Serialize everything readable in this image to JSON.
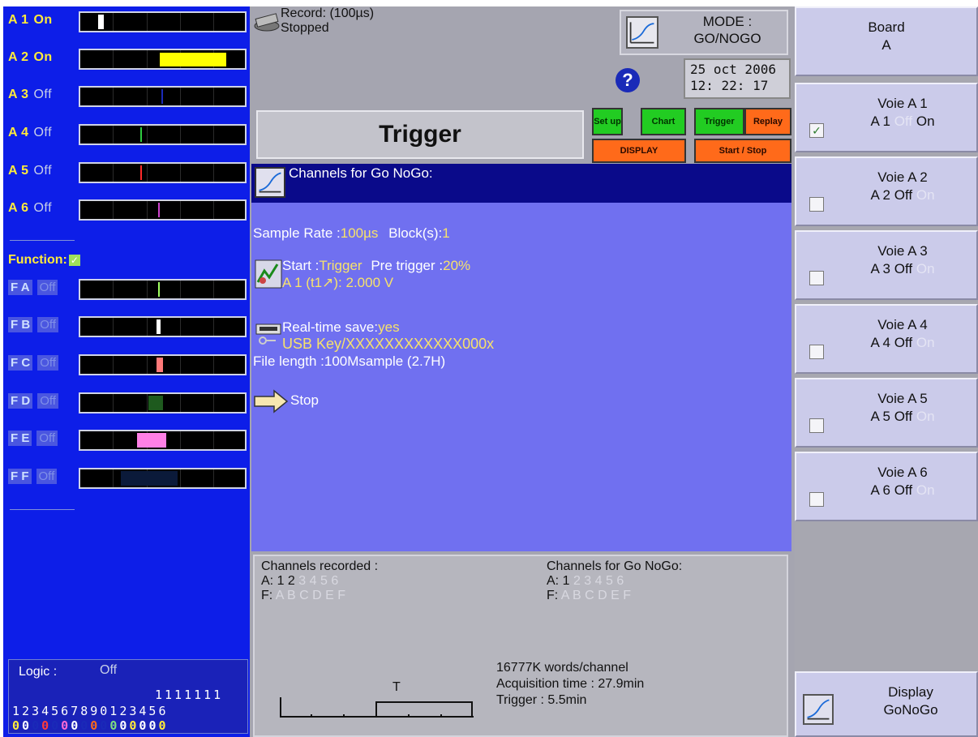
{
  "left": {
    "channels": [
      {
        "name": "A",
        "num": "1",
        "state": "On"
      },
      {
        "name": "A",
        "num": "2",
        "state": "On"
      },
      {
        "name": "A",
        "num": "3",
        "state": "Off"
      },
      {
        "name": "A",
        "num": "4",
        "state": "Off"
      },
      {
        "name": "A",
        "num": "5",
        "state": "Off"
      },
      {
        "name": "A",
        "num": "6",
        "state": "Off"
      }
    ],
    "function_label": "Function:",
    "function_check": "✓",
    "functions": [
      {
        "letter": "A",
        "state": "Off"
      },
      {
        "letter": "B",
        "state": "Off"
      },
      {
        "letter": "C",
        "state": "Off"
      },
      {
        "letter": "D",
        "state": "Off"
      },
      {
        "letter": "E",
        "state": "Off"
      },
      {
        "letter": "F",
        "state": "Off"
      }
    ],
    "logic": {
      "label": "Logic :",
      "value": "Off",
      "row1": "1111111",
      "row2": "1234567890123456",
      "row3": [
        "0",
        "0",
        "0",
        "0",
        "0",
        "0",
        "0",
        "0",
        "0",
        "0",
        "0",
        "0",
        "0",
        "0",
        "0",
        "0"
      ],
      "row3_colors": [
        "#ffeb3b",
        "#ffffff",
        "#1a2ab8",
        "#ff3b3b",
        "#1a2ab8",
        "#ff6ad5",
        "#ffffff",
        "#1a2ab8",
        "#ff6a1a",
        "#1a2ab8",
        "#7fe07f",
        "#ffffff",
        "#ffeb3b",
        "#ffffff",
        "#ffffff",
        "#ffeb3b"
      ]
    }
  },
  "center": {
    "record_line1": "Record: (100µs)",
    "record_line2": "Stopped",
    "mode_line1": "MODE :",
    "mode_line2": "GO/NOGO",
    "help": "?",
    "date": "25 oct 2006",
    "time": "12: 22: 17",
    "title": "Trigger",
    "tabs": {
      "setup": "Set up",
      "chart": "Chart",
      "trigger": "Trigger",
      "replay": "Replay",
      "display": "DISPLAY",
      "startstop": "Start / Stop"
    },
    "header": "Channels for Go NoGo:",
    "sample_rate_label": "Sample Rate :",
    "sample_rate_value": "100µs",
    "blocks_label": "Block(s):",
    "blocks_value": "1",
    "start_label": "Start :",
    "start_value": "Trigger",
    "pretrigger_label": "Pre trigger :",
    "pretrigger_value": "20%",
    "trigger_cond": "A 1 (t1↗):  2.000 V",
    "realtime_label": "Real-time save:",
    "realtime_value": "yes",
    "usb_path": "USB Key/XXXXXXXXXXXX000x",
    "file_length": "File length :100Msample  (2.7H)",
    "stop_label": "Stop",
    "bottom": {
      "recorded_title": "Channels recorded :",
      "recorded_a_prefix": "A:",
      "recorded_a_on": "1 2",
      "recorded_a_off": "3 4 5 6",
      "recorded_f_prefix": "F:",
      "recorded_f_off": "A B C D E F",
      "gonogo_title": "Channels for Go NoGo:",
      "gonogo_a_prefix": "A:",
      "gonogo_a_on": "1",
      "gonogo_a_off": "2 3 4 5 6",
      "gonogo_f_prefix": "F:",
      "gonogo_f_off": "A B C D E F",
      "t_label": "T",
      "words": "16777K words/channel",
      "acq_time": "Acquisition time : 27.9min",
      "trigger_time": "Trigger : 5.5min"
    }
  },
  "right": {
    "board_line1": "Board",
    "board_line2": "A",
    "voies": [
      {
        "title": "Voie   A 1",
        "label": "A 1",
        "off": "Off",
        "on": "On",
        "checked": true,
        "check": "✓"
      },
      {
        "title": "Voie   A 2",
        "label": "A 2",
        "off": "Off",
        "on": "On",
        "checked": false,
        "check": ""
      },
      {
        "title": "Voie   A 3",
        "label": "A 3",
        "off": "Off",
        "on": "On",
        "checked": false,
        "check": ""
      },
      {
        "title": "Voie   A 4",
        "label": "A 4",
        "off": "Off",
        "on": "On",
        "checked": false,
        "check": ""
      },
      {
        "title": "Voie   A 5",
        "label": "A 5",
        "off": "Off",
        "on": "On",
        "checked": false,
        "check": ""
      },
      {
        "title": "Voie   A 6",
        "label": "A 6",
        "off": "Off",
        "on": "On",
        "checked": false,
        "check": ""
      }
    ],
    "display_line1": "Display",
    "display_line2": "GoNoGo"
  }
}
